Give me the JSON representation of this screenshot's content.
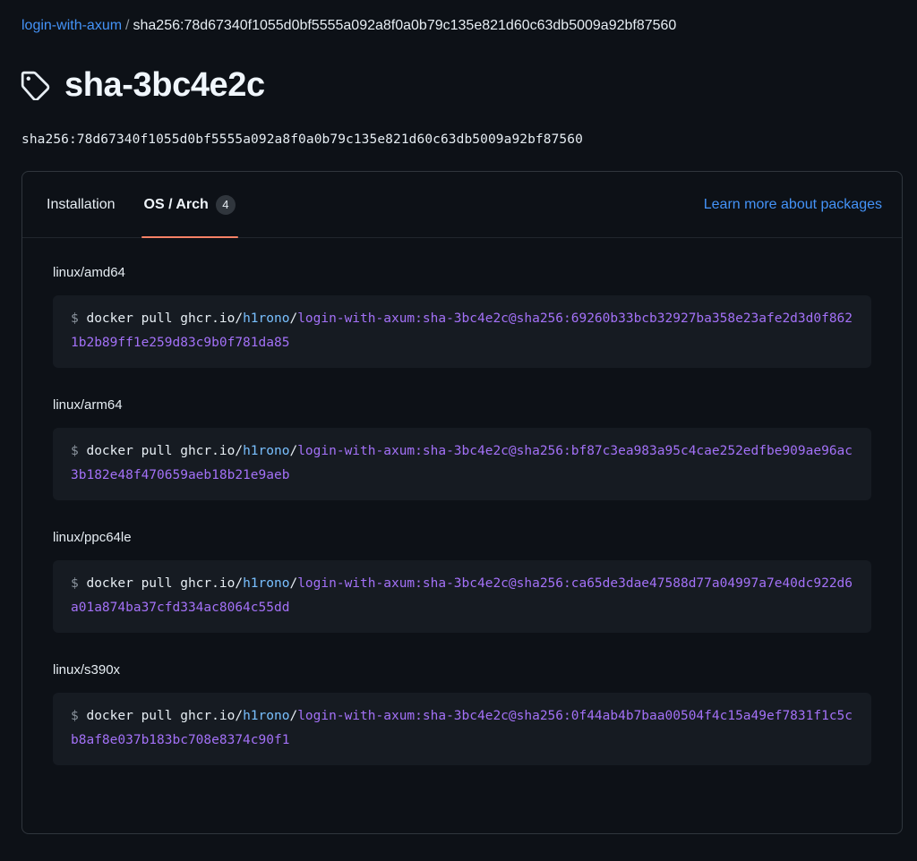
{
  "breadcrumb": {
    "repo_link": "login-with-axum",
    "separator": "/",
    "current": "sha256:78d67340f1055d0bf5555a092a8f0a0b79c135e821d60c63db5009a92bf87560"
  },
  "header": {
    "icon": "tag-icon",
    "title": "sha-3bc4e2c",
    "digest": "sha256:78d67340f1055d0bf5555a092a8f0a0b79c135e821d60c63db5009a92bf87560"
  },
  "tabs": [
    {
      "label": "Installation",
      "active": false,
      "counter": null
    },
    {
      "label": "OS / Arch",
      "active": true,
      "counter": "4"
    }
  ],
  "learn_more": {
    "label": "Learn more about packages"
  },
  "colors": {
    "page_bg": "#0d1117",
    "code_bg": "#161b22",
    "border": "#30363d",
    "link": "#4493f8",
    "accent_underline": "#f78166",
    "owner_token": "#79c0ff",
    "ref_token": "#a371f7",
    "prompt": "#8b949e",
    "text": "#e6edf3"
  },
  "platforms": [
    {
      "os_arch": "linux/amd64",
      "prompt": "$",
      "command": "docker pull ghcr.io/",
      "owner": "h1rono",
      "slash": "/",
      "ref": "login-with-axum:sha-3bc4e2c@sha256:69260b33bcb32927ba358e23afe2d3d0f8621b2b89ff1e259d83c9b0f781da85",
      "full_command": "$ docker pull ghcr.io/h1rono/login-with-axum:sha-3bc4e2c@sha256:69260b33bcb32927ba358e23afe2d3d0f8621b2b89ff1e259d83c9b0f781da85"
    },
    {
      "os_arch": "linux/arm64",
      "prompt": "$",
      "command": "docker pull ghcr.io/",
      "owner": "h1rono",
      "slash": "/",
      "ref": "login-with-axum:sha-3bc4e2c@sha256:bf87c3ea983a95c4cae252edfbe909ae96ac3b182e48f470659aeb18b21e9aeb",
      "full_command": "$ docker pull ghcr.io/h1rono/login-with-axum:sha-3bc4e2c@sha256:bf87c3ea983a95c4cae252edfbe909ae96ac3b182e48f470659aeb18b21e9aeb"
    },
    {
      "os_arch": "linux/ppc64le",
      "prompt": "$",
      "command": "docker pull ghcr.io/",
      "owner": "h1rono",
      "slash": "/",
      "ref": "login-with-axum:sha-3bc4e2c@sha256:ca65de3dae47588d77a04997a7e40dc922d6a01a874ba37cfd334ac8064c55dd",
      "full_command": "$ docker pull ghcr.io/h1rono/login-with-axum:sha-3bc4e2c@sha256:ca65de3dae47588d77a04997a7e40dc922d6a01a874ba37cfd334ac8064c55dd"
    },
    {
      "os_arch": "linux/s390x",
      "prompt": "$",
      "command": "docker pull ghcr.io/",
      "owner": "h1rono",
      "slash": "/",
      "ref": "login-with-axum:sha-3bc4e2c@sha256:0f44ab4b7baa00504f4c15a49ef7831f1c5cb8af8e037b183bc708e8374c90f1",
      "full_command": "$ docker pull ghcr.io/h1rono/login-with-axum:sha-3bc4e2c@sha256:0f44ab4b7baa00504f4c15a49ef7831f1c5cb8af8e037b183bc708e8374c90f1"
    }
  ]
}
